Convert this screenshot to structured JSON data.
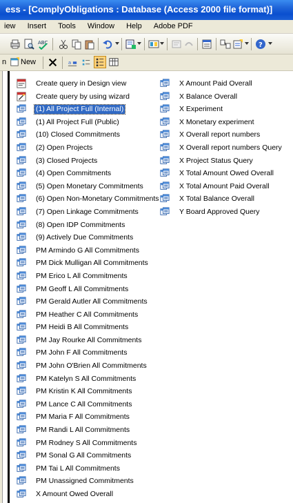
{
  "titlebar": {
    "text": "ess - [ComplyObligations : Database (Access 2000 file format)]"
  },
  "menu": [
    "iew",
    "Insert",
    "Tools",
    "Window",
    "Help",
    "Adobe PDF"
  ],
  "toolbar2": {
    "prefix": "n",
    "new_label": "New"
  },
  "left_column": [
    {
      "label": "Create query in Design view",
      "icon": "design-view-icon"
    },
    {
      "label": "Create query by using wizard",
      "icon": "wizard-icon"
    },
    {
      "label": "(1) All Project Full (Internal)",
      "icon": "query-icon",
      "selected": true
    },
    {
      "label": "(1) All Project Full (Public)",
      "icon": "query-icon"
    },
    {
      "label": "(10) Closed Commitments",
      "icon": "query-icon"
    },
    {
      "label": "(2) Open Projects",
      "icon": "query-icon"
    },
    {
      "label": "(3) Closed Projects",
      "icon": "query-icon"
    },
    {
      "label": "(4) Open Commitments",
      "icon": "query-icon"
    },
    {
      "label": "(5) Open Monetary Commitments",
      "icon": "query-icon"
    },
    {
      "label": "(6) Open Non-Monetary Commitments",
      "icon": "query-icon"
    },
    {
      "label": "(7) Open Linkage Commitments",
      "icon": "query-icon"
    },
    {
      "label": "(8) Open IDP Commitments",
      "icon": "query-icon"
    },
    {
      "label": "(9) Actively Due Commitments",
      "icon": "query-icon"
    },
    {
      "label": "PM Armindo G All Commitments",
      "icon": "query-icon"
    },
    {
      "label": "PM Dick Mulligan All Commitments",
      "icon": "query-icon"
    },
    {
      "label": "PM Erico L All Commitments",
      "icon": "query-icon"
    },
    {
      "label": "PM Geoff L All Commitments",
      "icon": "query-icon"
    },
    {
      "label": "PM Gerald Autler All Commitments",
      "icon": "query-icon"
    },
    {
      "label": "PM Heather C All Commitments",
      "icon": "query-icon"
    },
    {
      "label": "PM Heidi B All Commitments",
      "icon": "query-icon"
    },
    {
      "label": "PM Jay Rourke All Commitments",
      "icon": "query-icon"
    },
    {
      "label": "PM John F All Commitments",
      "icon": "query-icon"
    },
    {
      "label": "PM John O'Brien All Commitments",
      "icon": "query-icon"
    },
    {
      "label": "PM Katelyn S All Commitments",
      "icon": "query-icon"
    },
    {
      "label": "PM Kristin K All Commitments",
      "icon": "query-icon"
    },
    {
      "label": "PM Lance C All Commitments",
      "icon": "query-icon"
    },
    {
      "label": "PM Maria F All Commitments",
      "icon": "query-icon"
    },
    {
      "label": "PM Randi L All Commitments",
      "icon": "query-icon"
    },
    {
      "label": "PM Rodney S All Commitments",
      "icon": "query-icon"
    },
    {
      "label": "PM Sonal G All Commitments",
      "icon": "query-icon"
    },
    {
      "label": "PM Tai L All Commitments",
      "icon": "query-icon"
    },
    {
      "label": "PM Unassigned Commitments",
      "icon": "query-icon"
    },
    {
      "label": "X Amount Owed Overall",
      "icon": "query-icon"
    }
  ],
  "right_column": [
    {
      "label": "X Amount Paid Overall",
      "icon": "query-icon"
    },
    {
      "label": "X Balance Overall",
      "icon": "query-icon"
    },
    {
      "label": "X Experiment",
      "icon": "query-icon"
    },
    {
      "label": "X Monetary experiment",
      "icon": "query-icon"
    },
    {
      "label": "X Overall report numbers",
      "icon": "query-icon"
    },
    {
      "label": "X Overall report numbers Query",
      "icon": "query-icon"
    },
    {
      "label": "X Project Status Query",
      "icon": "query-icon"
    },
    {
      "label": "X Total Amount Owed Overall",
      "icon": "query-icon"
    },
    {
      "label": "X Total Amount Paid Overall",
      "icon": "query-icon"
    },
    {
      "label": "X Total Balance Overall",
      "icon": "query-icon"
    },
    {
      "label": "Y Board Approved Query",
      "icon": "query-icon"
    }
  ],
  "colors": {
    "titlebar": "#0a4fcf",
    "selection": "#316ac5",
    "chrome": "#ece9d8"
  }
}
